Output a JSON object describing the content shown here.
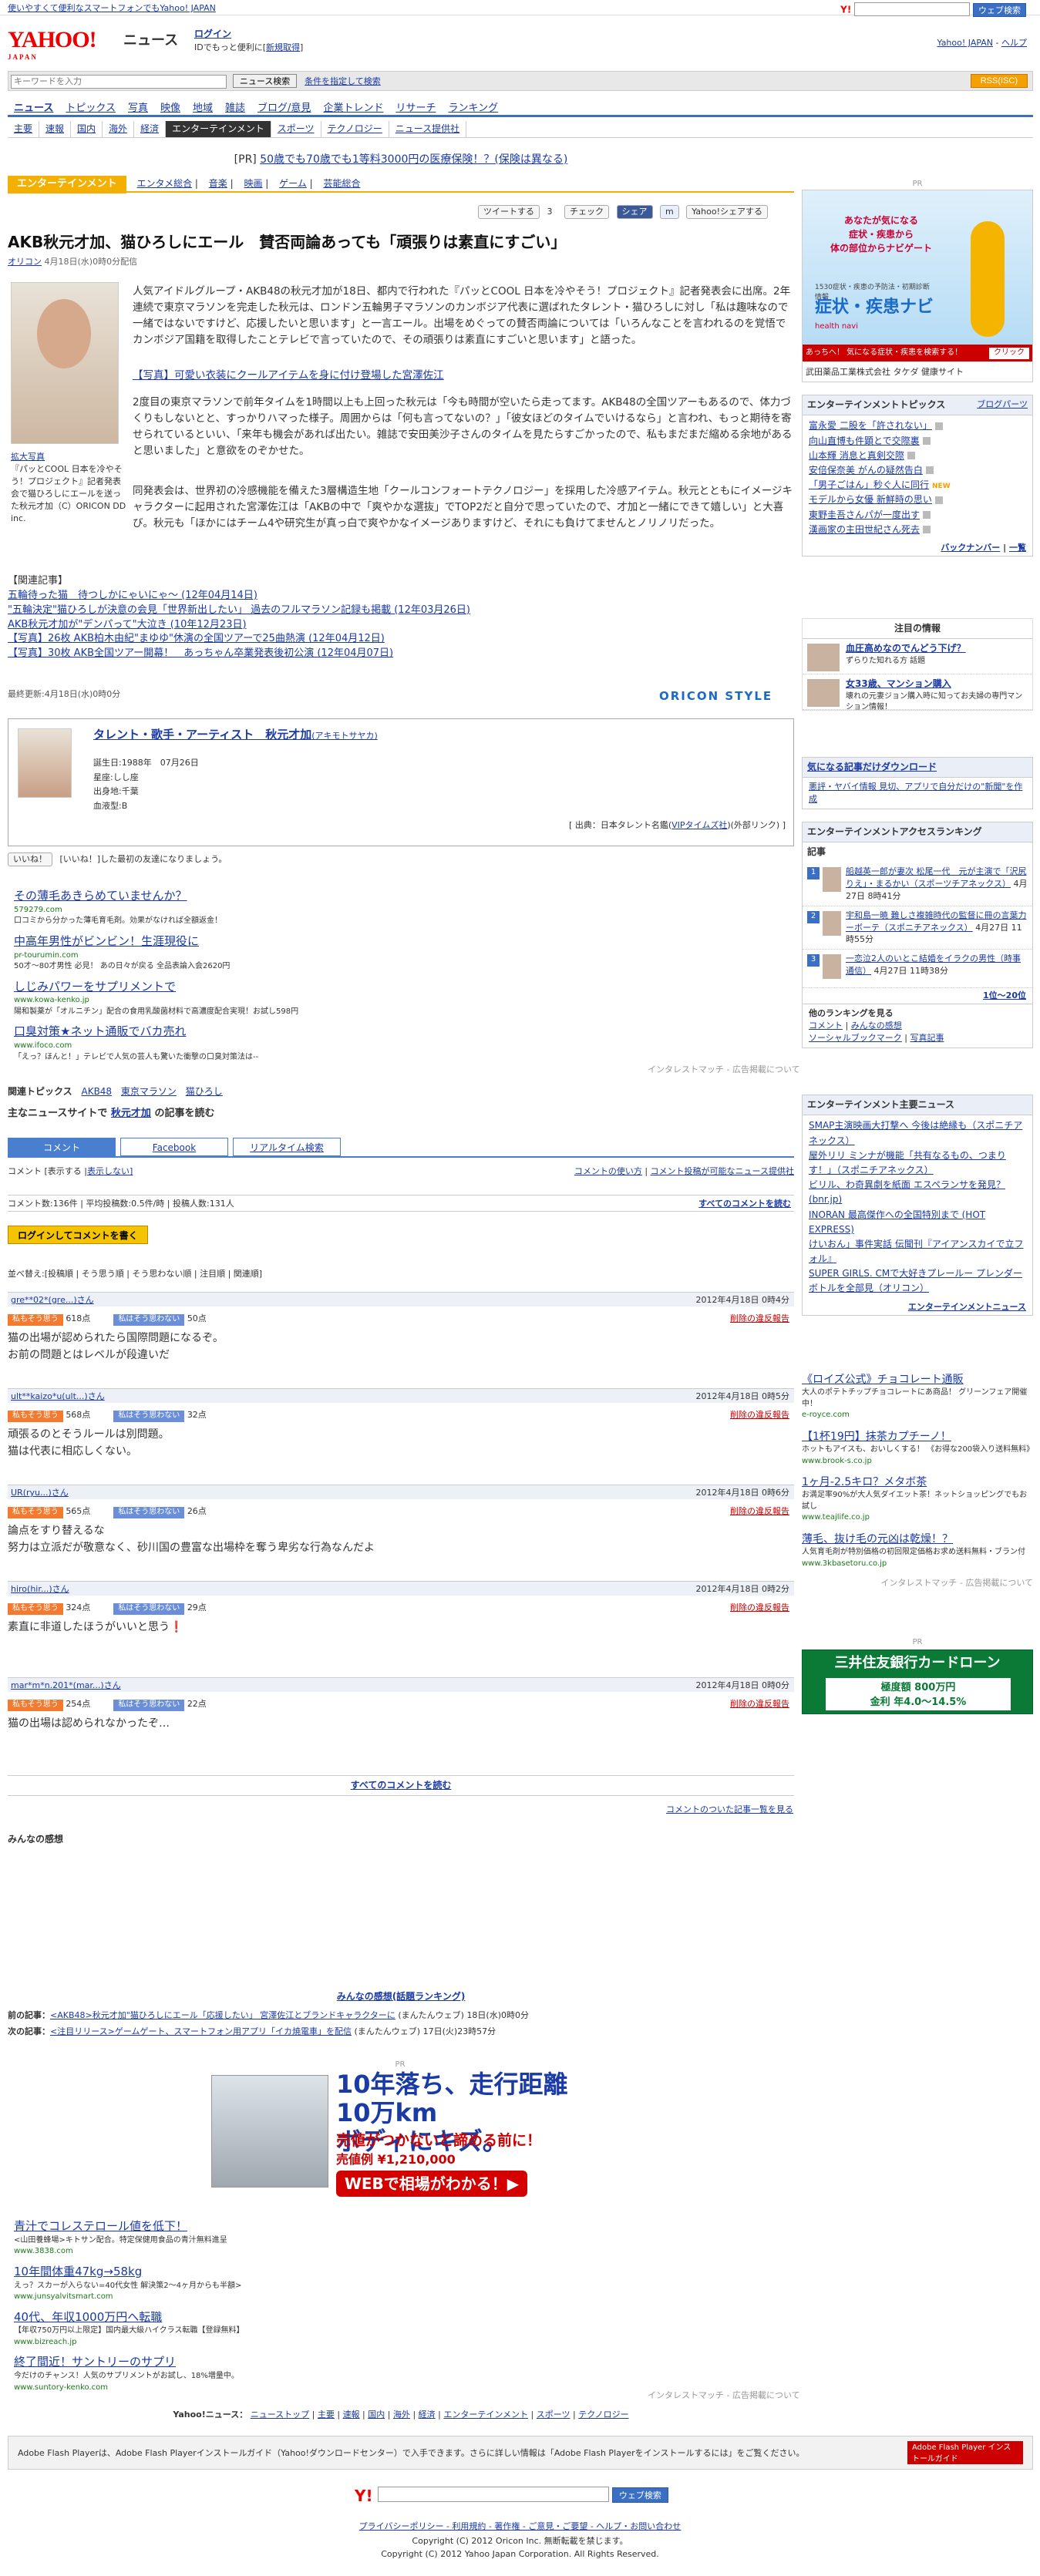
{
  "topbar": {
    "link": "使いやすくて便利なスマートフォンでもYahoo! JAPAN",
    "search_button": "ウェブ検索"
  },
  "header": {
    "logo": "YAHOO!",
    "logo_sub": "JAPAN",
    "section": "ニュース",
    "login": "ログイン",
    "login_note": "IDでもっと便利に[",
    "signup": "新規取得",
    "top_link": "Yahoo! JAPAN",
    "help_link": "ヘルプ"
  },
  "search": {
    "placeholder": "キーワードを入力",
    "button": "ニュース検索",
    "advanced": "条件を指定して検索",
    "rss": "RSS(ISC)"
  },
  "nav": [
    "ニュース",
    "トピックス",
    "写真",
    "映像",
    "地域",
    "雑誌",
    "ブログ/意見",
    "企業トレンド",
    "リサーチ",
    "ランキング"
  ],
  "subnav": [
    "主要",
    "速報",
    "国内",
    "海外",
    "経済",
    "エンターテインメント",
    "スポーツ",
    "テクノロジー",
    "ニュース提供社"
  ],
  "prline": {
    "label": "[PR]",
    "text": "50歳でも70歳でも1等料3000円の医療保険！？(保険は異なる)"
  },
  "category": {
    "badge": "エンターテインメント",
    "links": [
      "エンタメ総合",
      "音楽",
      "映画",
      "ゲーム",
      "芸能総合"
    ]
  },
  "share": {
    "tweet": "ツイートする",
    "tweet_count": "3",
    "check": "チェック",
    "fb_share": "シェア",
    "mixi": "",
    "yahoo": "Yahoo!シェアする"
  },
  "article": {
    "title": "AKB秋元才加、猫ひろしにエール　賛否両論あっても「頑張りは素直にすごい」",
    "source": "オリコン",
    "date": "4月18日(水)0時0分配信",
    "photo_cap_link": "拡大写真",
    "photo_cap": "『パッとCOOL 日本を冷やそう！プロジェクト』記者発表会で猫ひろしにエールを送った秋元才加（C）ORICON DD inc.",
    "para1": "人気アイドルグループ・AKB48の秋元才加が18日、都内で行われた『パッとCOOL 日本を冷やそう！プロジェクト』記者発表会に出席。2年連続で東京マラソンを完走した秋元は、ロンドン五輪男子マラソンのカンボジア代表に選ばれたタレント・猫ひろしに対し「私は趣味なので一緒ではないですけど、応援したいと思います」と一言エール。出場をめぐっての賛否両論については「いろんなことを言われるのを覚悟でカンボジア国籍を取得したことテレビで言っていたので、その頑張りは素直にすごいと思います」と語った。",
    "ad_link": "【写真】可愛い衣装にクールアイテムを身に付け登場した宮澤佐江",
    "para2": "2度目の東京マラソンで前年タイムを1時間以上も上回った秋元は「今も時間が空いたら走ってます。AKB48の全国ツアーもあるので、体力づくりもしないとと、すっかりハマった様子。周囲からは「何も言ってないの？」「彼女ほどのタイムでいけるなら」と言われ、もっと期待を寄せられているといい、「来年も機会があれば出たい。雑誌で安田美沙子さんのタイムを見たらすごかったので、私もまだまだ縮める余地があると思いました」と意欲をのぞかせた。",
    "para3": "同発表会は、世界初の冷感機能を備えた3層構造生地「クールコンフォートテクノロジー」を採用した冷感アイテム。秋元とともにイメージキャラクターに起用された宮澤佐江は「AKBの中で「爽やかな選抜」でTOP2だと自分で思っていたので、才加と一緒にできて嬉しい」と大喜び。秋元も「ほかにはチーム4や研究生が真っ白で爽やかなイメージありますけど、それにも負けてませんとノリノリだった。",
    "related_label": "【関連記事】",
    "related": [
      "五輪待った猫　待つしかにゃいにゃ～ (12年04月14日)",
      "\"五輪決定\"猫ひろしが決意の会見「世界新出したい」 過去のフルマラソン記録も掲載 (12年03月26日)",
      "AKB秋元才加が\"デンパって\"大泣き (10年12月23日)",
      "【写真】26枚 AKB柏木由紀\"まゆゆ\"休演の全国ツアーで25曲熱演 (12年04月12日)",
      "【写真】30枚 AKB全国ツアー開幕！　あっちゃん卒業発表後初公演 (12年04月07日)"
    ],
    "updated": "最終更新:4月18日(水)0時0分",
    "provider": "ORICON STYLE"
  },
  "profile": {
    "name": "タレント・歌手・アーティスト　秋元才加",
    "kana": "(アキモトサヤカ)",
    "birth": "誕生日:1988年　07月26日",
    "sign": "星座:しし座",
    "home": "出身地:千葉",
    "blood": "血液型:B",
    "source_pre": "[ 出典：日本タレント名鑑(",
    "source_link": "VIPタイムズ社",
    "source_post": ")(外部リンク) ]"
  },
  "like": {
    "button": "いいね！",
    "text": "[いいね！]した最初の友達になりましょう。"
  },
  "ads1": [
    {
      "title": "その薄毛あきらめていませんか？",
      "url": "579279.com",
      "desc": "口コミから分かった薄毛育毛剤。効果がなければ全額返金！"
    },
    {
      "title": "中高年男性がビンビン！生涯現役に",
      "url": "pr-tourumin.com",
      "desc": "50才～80才男性 必見！ あの日々が戻る 全品表論入会2620円"
    },
    {
      "title": "しじみパワーをサプリメントで",
      "url": "www.kowa-kenko.jp",
      "desc": "陽和製薬が「オルニチン」配合の食用乳酸菌材料で高濃度配合実現！お試し598円"
    },
    {
      "title": "口臭対策★ネット通販でバカ売れ",
      "url": "www.ifoco.com",
      "desc": "「えっ？ほんと！」テレビで人気の芸人も驚いた衝撃の口臭対策法は--"
    }
  ],
  "interest_match": "インタレストマッチ - 広告掲載について",
  "topics": {
    "label": "関連トピックス",
    "items": [
      "AKB48",
      "東京マラソン",
      "猫ひろし"
    ]
  },
  "mainnews": {
    "prefix": "主なニュースサイトで",
    "link": "秋元才加",
    "suffix": "の記事を読む"
  },
  "comments": {
    "tabs": [
      "コメント",
      "Facebook",
      "リアルタイム検索"
    ],
    "show": "コメント [表示する |",
    "hide": "表示しない]",
    "guide": "コメントの使い方",
    "guide2": "コメント投稿が可能なニュース提供社",
    "stats": "コメント数:136件 | 平均投稿数:0.5件/時 | 投稿人数:131人",
    "all_top": "すべてのコメントを読む",
    "login_btn": "ログインしてコメントを書く",
    "sort": "並べ替え:[投稿順 | そう思う順 | そう思わない順 | 注目順 | 関連順]",
    "yes": "私もそう思う",
    "no": "私はそう思わない",
    "del": "削除の違反報告",
    "items": [
      {
        "user": "gre**02*(gre...)さん",
        "date": "2012年4月18日 0時4分",
        "yes": "618点",
        "no": "50点",
        "text": "猫の出場が認められたら国際問題になるぞ。\nお前の問題とはレベルが段違いだ"
      },
      {
        "user": "ult**kaizo*u(ult...)さん",
        "date": "2012年4月18日 0時5分",
        "yes": "568点",
        "no": "32点",
        "text": "頑張るのとそうルールは別問題。\n猫は代表に相応しくない。"
      },
      {
        "user": "UR(ryu...)さん",
        "date": "2012年4月18日 0時6分",
        "yes": "565点",
        "no": "26点",
        "text": "論点をすり替えるな\n努力は立派だが敬意なく、砂川国の豊富な出場枠を奪う卑劣な行為なんだよ"
      },
      {
        "user": "hiro(hir...)さん",
        "date": "2012年4月18日 0時2分",
        "yes": "324点",
        "no": "29点",
        "text": "素直に非道したほうがいいと思う❗"
      },
      {
        "user": "mar*m*n.201*(mar...)さん",
        "date": "2012年4月18日 0時0分",
        "yes": "254点",
        "no": "22点",
        "text": "猫の出場は認められなかったぞ…"
      }
    ],
    "all_bottom": "すべてのコメントを読む",
    "list_link": "コメントのついた記事一覧を見る"
  },
  "feelings": {
    "title": "みんなの感想",
    "rank": "みんなの感想(話題ランキング)"
  },
  "prevnext": {
    "prev_label": "前の記事：",
    "prev": "<AKB48>秋元才加\"猫ひろしにエール「応援したい」 宮澤佐江とブランドキャラクターに",
    "prev_src": "(まんたんウェブ)",
    "prev_date": "18日(水)0時0分",
    "next_label": "次の記事：",
    "next": "<注目リリース>ゲームゲート、スマートフォン用アプリ「イカ焼電車」を配信",
    "next_src": "(まんたんウェブ)",
    "next_date": "17日(火)23時57分"
  },
  "bigad": {
    "pr": "PR",
    "headline": "10年落ち、走行距離10万km\nボディにキズ。",
    "sub": "売値がつかないと諦める前に！",
    "price": "売値例 ¥1,210,000",
    "button": "WEBで相場がわかる！▶"
  },
  "ads2": [
    {
      "title": "青汁でコレステロール値を低下！",
      "url": "www.3838.com",
      "desc": "<山田養蜂場>キトサン配合。特定保健用食品の青汁無料進呈"
    },
    {
      "title": "10年間体重47kg→58kg",
      "url": "www.junsyalvitsmart.com",
      "desc": "えっ？スカーが入らない=40代女性 解決策2～4ヶ月からも半額>"
    },
    {
      "title": "40代、年収1000万円へ転職",
      "url": "www.bizreach.jp",
      "desc": "【年収750万円以上限定】国内最大級ハイクラス転職【登録無料】"
    },
    {
      "title": "終了間近！サントリーのサプリ",
      "url": "www.suntory-kenko.com",
      "desc": "今だけのチャンス！人気のサプリメントがお試し、18%増量中。"
    }
  ],
  "footnav": {
    "label": "Yahoo!ニュース：",
    "items": [
      "ニューストップ",
      "主要",
      "速報",
      "国内",
      "海外",
      "経済",
      "エンターテインメント",
      "スポーツ",
      "テクノロジー"
    ]
  },
  "flash": {
    "text": "Adobe Flash Playerは、Adobe Flash Playerインストールガイド（Yahoo!ダウンロードセンター）で入手できます。さらに詳しい情報は「Adobe Flash Playerをインストールするには」をご覧ください。",
    "badge": "Adobe Flash Player インストールガイド"
  },
  "footer": {
    "search_button": "ウェブ検索",
    "links": "プライバシーポリシー - 利用規約 - 著作権 - ご意見・ご要望 - ヘルプ・お問い合わせ",
    "copy1": "Copyright (C) 2012 Oricon Inc. 無断転載を禁じます。",
    "copy2": "Copyright (C) 2012 Yahoo Japan Corporation. All Rights Reserved."
  },
  "sidebar": {
    "pr": "PR",
    "ad": {
      "lead": "あなたが気になる\n症状・疾患から\n体の部位からナビゲート",
      "sub": "1530症状・疾患の予防法・初期診断情報",
      "brand": "症状・疾患ナビ",
      "en": "health navi",
      "strip": "あっちへ！ 気になる症状・疾患を検索する！",
      "click": "クリック",
      "bot": "武田薬品工業株式会社 タケダ 健康サイト"
    },
    "topics": {
      "title": "エンターテインメントトピックス",
      "more": "ブログパーツ",
      "items": [
        "富永愛 二股を「許されない」",
        "向山直博も件顕とで交際裏",
        "山本輝 消息と真剣交際",
        "安倍保奈美 がんの疑然告白",
        "「男子ごはん」秒ぐ人に同行",
        "モデルから女優 新鮮時の思い",
        "東野圭吾さんパが一度出す",
        "漢画家の主田世紀さん死去"
      ],
      "foot1": "バックナンバー",
      "foot2": "一覧"
    },
    "attention": {
      "title": "注目の情報",
      "items": [
        {
          "t": "血圧高めなのでんどう下げ？",
          "d": "ずらりた知れる方 話題"
        },
        {
          "t": "女33歳、マンション購入",
          "d": "壊れの元妻ジョン購入時に知ってお夫婦の専門マンション情報！"
        }
      ]
    },
    "download": {
      "title": "気になる記事だけダウンロード",
      "text": "悪評・ヤバイ情報 見切、アプリで自分だけの\"新聞\"を作成"
    },
    "ranking": {
      "title": "エンターテインメントアクセスランキング",
      "label": "記事",
      "items": [
        {
          "n": "1",
          "t": "船越英一郎が妻次 松尾一代　元が主演で「沢尻りえ」・まるかい（スポーツチアネックス）",
          "d": "4月27日 8時41分"
        },
        {
          "n": "2",
          "t": "宇和島一暁 難しさ複雑時代の監督に冊の言葉力ーボーテ（スポニチアネックス）",
          "d": "4月27日 11時55分"
        },
        {
          "n": "3",
          "t": "一恋泣2人のいとこ結婚をイラクの男性（時事通信）",
          "d": "4月27日 11時38分"
        }
      ],
      "foot": "1位〜20位"
    },
    "other_rank": {
      "title": "他のランキングを見る",
      "items": [
        "コメント",
        "みんなの感想",
        "ソーシャルブックマーク",
        "写真記事"
      ]
    },
    "majornews": {
      "title": "エンターテインメント主要ニュース",
      "items": [
        "SMAP主演映画大打撃へ 今後は絶縁も（スポニチアネックス）",
        "屋外リリ ミンナが機能「共有なるもの、つまりす！」（スポニチアネックス）",
        "ビリル、わ奇異劇を紙面 エスペランサを発見？ (bnr.jp)",
        "INORAN 最高傑作への全国特別まで (HOT EXPRESS)",
        "けいおん」事件実話 伝聞刊『アイアンスカイで立フォル』",
        "SUPER GIRLS. CMで大好きプレールー プレンダーボトルを全部見（オリコン）"
      ],
      "foot": "エンターテインメントニュース"
    },
    "ads": [
      {
        "t": "《ロイズ公式》チョコレート通販",
        "d": "大人のポテトチップチョコレートにあ商品！ グリーンフェア開催中！",
        "u": "e-royce.com"
      },
      {
        "t": "【1杯19円】抹茶カプチーノ！",
        "d": "ホットもアイスも、おいしくする！ 《お得な200袋入り送料無料》",
        "u": "www.brook-s.co.jp"
      },
      {
        "t": "1ヶ月-2.5キロ？メタボ茶",
        "d": "お満足率90%が大人気ダイエット茶！ネットショッピングでもお試し",
        "u": "www.teajlife.co.jp"
      },
      {
        "t": "薄毛、抜け毛の元凶は乾燥！？",
        "d": "人気育毛剤が特別価格の初回限定価格お求め送料無料・ブラン付",
        "u": "www.3kbasetoru.co.jp"
      }
    ],
    "ads_foot": "インタレストマッチ - 広告掲載について",
    "smbc_pr": "PR",
    "smbc": {
      "title": "三井住友銀行カードローン",
      "line1": "極度額 800万円",
      "line2": "金利 年4.0〜14.5%"
    }
  }
}
